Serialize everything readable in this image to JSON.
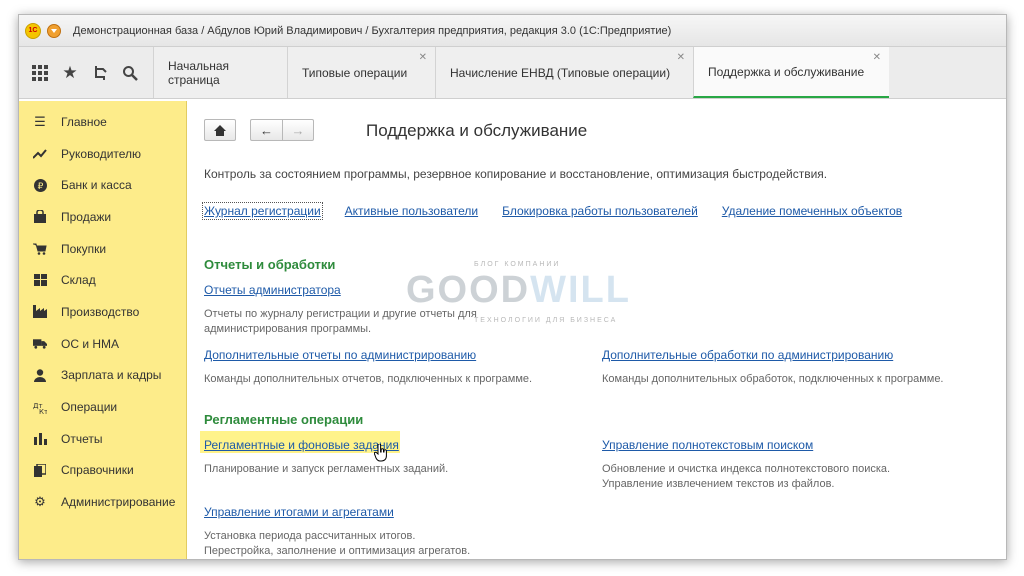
{
  "window": {
    "title": "Демонстрационная база / Абдулов Юрий Владимирович / Бухгалтерия предприятия, редакция 3.0  (1С:Предприятие)",
    "logo_text": "1С"
  },
  "toolbar": {
    "icons": [
      "grid-icon",
      "star-icon",
      "history-icon",
      "search-icon"
    ]
  },
  "tabs": [
    {
      "label": "Начальная страница",
      "closable": false,
      "active": false
    },
    {
      "label": "Типовые операции",
      "closable": true,
      "active": false
    },
    {
      "label": "Начисление ЕНВД (Типовые операции)",
      "closable": true,
      "active": false
    },
    {
      "label": "Поддержка и обслуживание",
      "closable": true,
      "active": true
    }
  ],
  "sidebar": {
    "items": [
      {
        "label": "Главное",
        "icon": "menu-lines-icon"
      },
      {
        "label": "Руководителю",
        "icon": "trend-icon"
      },
      {
        "label": "Банк и касса",
        "icon": "ruble-icon"
      },
      {
        "label": "Продажи",
        "icon": "bag-icon"
      },
      {
        "label": "Покупки",
        "icon": "cart-icon"
      },
      {
        "label": "Склад",
        "icon": "warehouse-icon"
      },
      {
        "label": "Производство",
        "icon": "factory-icon"
      },
      {
        "label": "ОС и НМА",
        "icon": "truck-icon"
      },
      {
        "label": "Зарплата и кадры",
        "icon": "person-icon"
      },
      {
        "label": "Операции",
        "icon": "operations-icon"
      },
      {
        "label": "Отчеты",
        "icon": "bar-chart-icon"
      },
      {
        "label": "Справочники",
        "icon": "books-icon"
      },
      {
        "label": "Администрирование",
        "icon": "gear-icon"
      }
    ]
  },
  "content": {
    "title": "Поддержка и обслуживание",
    "description": "Контроль за состоянием программы, резервное копирование и восстановление, оптимизация быстродействия.",
    "top_links": [
      "Журнал регистрации",
      "Активные пользователи",
      "Блокировка работы пользователей",
      "Удаление помеченных объектов"
    ],
    "section_reports": {
      "title": "Отчеты и обработки",
      "admin_reports": {
        "link": "Отчеты администратора",
        "note": "Отчеты по журналу регистрации и другие отчеты для администрирования программы."
      },
      "extra_reports": {
        "link": "Дополнительные отчеты по администрированию",
        "note": "Команды дополнительных отчетов, подключенных к программе."
      },
      "extra_processing": {
        "link": "Дополнительные обработки по администрированию",
        "note": "Команды дополнительных обработок, подключенных к программе."
      }
    },
    "section_routine": {
      "title": "Регламентные операции",
      "scheduled_jobs": {
        "link": "Регламентные и фоновые задания",
        "note": "Планирование и запуск регламентных заданий."
      },
      "fulltext_search": {
        "link": "Управление полнотекстовым поиском",
        "note1": "Обновление и очистка индекса полнотекстового поиска.",
        "note2": "Управление извлечением текстов из файлов."
      },
      "totals": {
        "link": "Управление итогами и агрегатами",
        "note1": "Установка периода рассчитанных итогов.",
        "note2": "Перестройка, заполнение и оптимизация агрегатов."
      }
    }
  },
  "watermark": {
    "top": "БЛОГ КОМПАНИИ",
    "part1": "GOOD",
    "part2": "WILL",
    "bottom": "ТЕХНОЛОГИИ ДЛЯ БИЗНЕСА"
  },
  "colors": {
    "sidebar_bg": "#fdec8a",
    "link": "#1e5aa8",
    "section_title": "#2e8b3c",
    "active_tab_underline": "#28a745",
    "highlight": "#fff38a"
  }
}
